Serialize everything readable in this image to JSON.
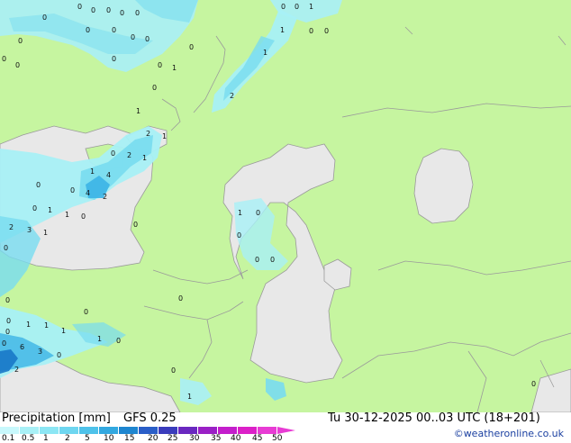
{
  "map": {
    "colors": {
      "land": "#c6f5a0",
      "water": "#e8e8e8",
      "border": "#9a9a9a",
      "precip_light": "#a8f0f6",
      "precip_mid": "#78dcf0",
      "precip_heavy": "#3cb4e6",
      "precip_strong": "#1878c8"
    },
    "value_labels": [
      {
        "text": "0"
      },
      {
        "text": "0"
      },
      {
        "text": "0"
      },
      {
        "text": "0"
      },
      {
        "text": "0"
      },
      {
        "text": "0"
      },
      {
        "text": "0"
      },
      {
        "text": "0"
      },
      {
        "text": "0"
      },
      {
        "text": "0"
      },
      {
        "text": "0"
      },
      {
        "text": "0"
      },
      {
        "text": "0"
      },
      {
        "text": "0"
      },
      {
        "text": "0"
      },
      {
        "text": "0"
      },
      {
        "text": "1"
      },
      {
        "text": "0"
      },
      {
        "text": "1"
      },
      {
        "text": "0"
      },
      {
        "text": "0"
      },
      {
        "text": "1"
      },
      {
        "text": "1"
      },
      {
        "text": "2"
      },
      {
        "text": "1"
      },
      {
        "text": "0"
      },
      {
        "text": "0"
      },
      {
        "text": "2"
      },
      {
        "text": "1"
      },
      {
        "text": "0"
      },
      {
        "text": "2"
      },
      {
        "text": "1"
      },
      {
        "text": "1"
      },
      {
        "text": "4"
      },
      {
        "text": "0"
      },
      {
        "text": "0"
      },
      {
        "text": "4"
      },
      {
        "text": "2"
      },
      {
        "text": "0"
      },
      {
        "text": "1"
      },
      {
        "text": "1"
      },
      {
        "text": "0"
      },
      {
        "text": "0"
      },
      {
        "text": "2"
      },
      {
        "text": "3"
      },
      {
        "text": "1"
      },
      {
        "text": "0"
      },
      {
        "text": "1"
      },
      {
        "text": "0"
      },
      {
        "text": "0"
      },
      {
        "text": "0"
      },
      {
        "text": "0"
      },
      {
        "text": "0"
      },
      {
        "text": "0"
      },
      {
        "text": "0"
      },
      {
        "text": "1"
      },
      {
        "text": "1"
      },
      {
        "text": "1"
      },
      {
        "text": "0"
      },
      {
        "text": "1"
      },
      {
        "text": "0"
      },
      {
        "text": "0"
      },
      {
        "text": "6"
      },
      {
        "text": "3"
      },
      {
        "text": "0"
      },
      {
        "text": "2"
      },
      {
        "text": "0"
      },
      {
        "text": "1"
      },
      {
        "text": "0"
      },
      {
        "text": "0"
      }
    ]
  },
  "footer": {
    "title": "Precipitation [mm]",
    "model": "GFS 0.25",
    "datetime": "Tu 30-12-2025 00..03 UTC (18+201)",
    "credit": "©weatheronline.co.uk",
    "scale": {
      "ticks": [
        "0.1",
        "0.5",
        "1",
        "2",
        "5",
        "10",
        "15",
        "20",
        "25",
        "30",
        "35",
        "40",
        "45",
        "50"
      ],
      "colors": [
        "#c8f8fc",
        "#a8f0f6",
        "#8ce6f4",
        "#6ed6f0",
        "#4ec2ea",
        "#32a8e0",
        "#1e86d0",
        "#2a5ec8",
        "#3a3cbc",
        "#6a28c0",
        "#9a20c6",
        "#c41ecc",
        "#dc20c8",
        "#e83cd4"
      ]
    }
  }
}
